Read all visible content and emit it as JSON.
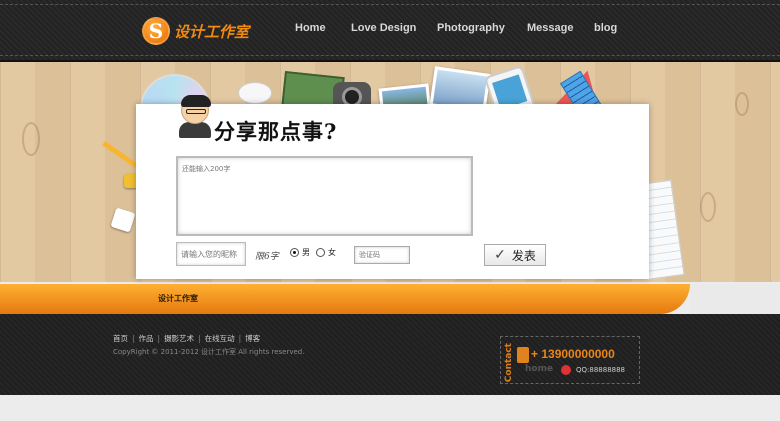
{
  "brand": {
    "logo_letter": "S",
    "name": "设计工作室"
  },
  "nav": {
    "items": [
      "Home",
      "Love Design",
      "Photography",
      "Message",
      "blog"
    ]
  },
  "form": {
    "title": "分享那点事?",
    "message_placeholder": "还能输入200字",
    "name_placeholder": "请输入您的昵称",
    "remaining_label": "限6字",
    "gender_options": [
      "男",
      "女"
    ],
    "gender_selected": "男",
    "captcha_placeholder": "验证码",
    "submit_label": "发表",
    "submit_check": "✓"
  },
  "strip": {
    "label": "设计工作室"
  },
  "footer": {
    "links": [
      "首页",
      "作品",
      "摄影艺术",
      "在线互动",
      "博客"
    ],
    "copyright": "CopyRight © 2011-2012 设计工作室 All rights reserved.",
    "contact_label": "Contact",
    "phone_prefix": "+",
    "phone": "13900000000",
    "home_label": "home",
    "qq": "QQ:88888888"
  },
  "colors": {
    "accent": "#f08a10",
    "header_bg": "#262626",
    "wood": "#e0c59e"
  },
  "icons": {
    "submit": "check-icon",
    "phone": "phone-icon",
    "qq": "qq-icon",
    "avatar": "avatar-icon"
  }
}
